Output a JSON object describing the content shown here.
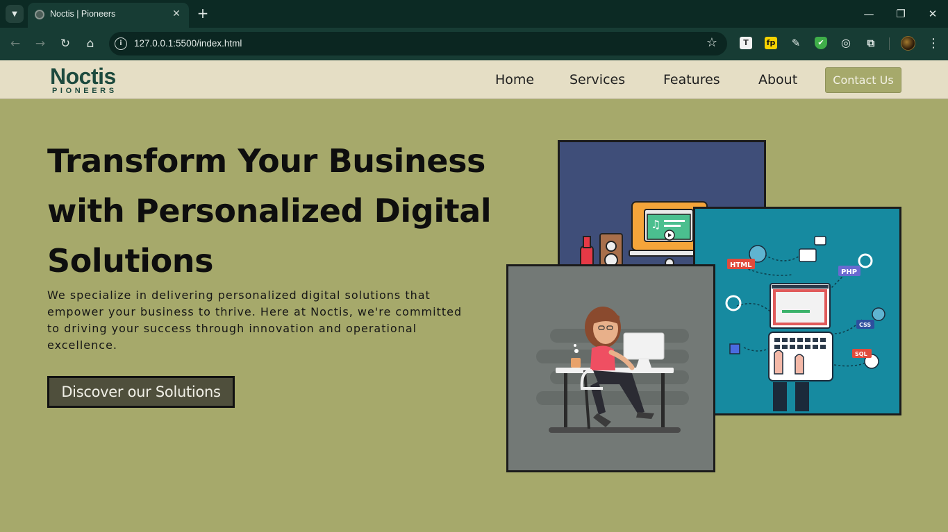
{
  "browser": {
    "tab_title": "Noctis | Pioneers",
    "url": "127.0.0.1:5500/index.html",
    "controls": {
      "back": "←",
      "forward": "→",
      "reload": "↻",
      "home": "⌂",
      "new_tab": "+",
      "close": "✕",
      "minimize": "—",
      "restore": "❐",
      "window_close": "✕",
      "menu": "⋮",
      "star": "☆"
    },
    "extensions": [
      "T",
      "fp",
      "✎",
      "✔",
      "◎",
      "⧉"
    ]
  },
  "site": {
    "logo_main": "Noctis",
    "logo_sub": "PIONEERS",
    "nav": [
      "Home",
      "Services",
      "Features",
      "About"
    ],
    "contact_label": "Contact Us"
  },
  "hero": {
    "title": "Transform Your Business with Personalized Digital Solutions",
    "text": "We specialize in delivering personalized digital solutions that empower your business to thrive. Here at Noctis, we're committed to driving your success through innovation and operational excellence.",
    "cta_label": "Discover our Solutions"
  },
  "illustration_labels": {
    "html": "HTML",
    "php": "PHP",
    "css": "CSS",
    "sql": "SQL"
  },
  "colors": {
    "hero_bg": "#a6a96b",
    "header_bg": "#e5dec5",
    "brand_green": "#1d4a3e",
    "cta_bg": "#4f4f3c"
  }
}
